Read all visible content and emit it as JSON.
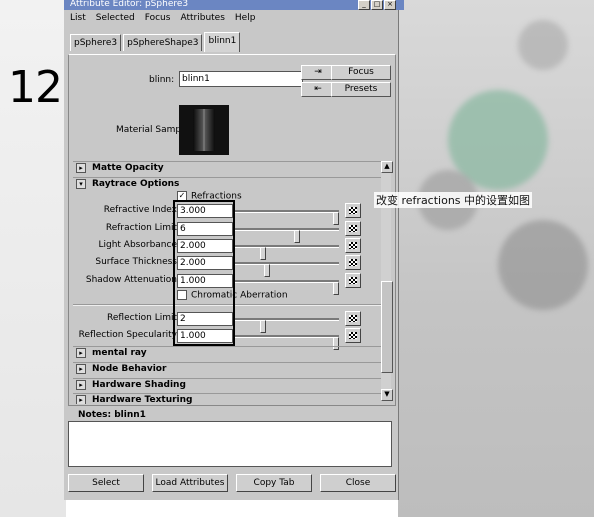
{
  "step_number": "12",
  "annotation": "改变 refractions 中的设置如图",
  "window": {
    "title": "Attribute Editor: pSphere3",
    "menu": [
      "List",
      "Selected",
      "Focus",
      "Attributes",
      "Help"
    ],
    "tabs": [
      "pSphere3",
      "pSphereShape3",
      "blinn1"
    ],
    "active_tab": 2
  },
  "node": {
    "label": "blinn:",
    "value": "blinn1",
    "focus_label": "Focus",
    "presets_label": "Presets",
    "material_sample_label": "Material Sample"
  },
  "sections": {
    "matte_opacity": "Matte Opacity",
    "raytrace_options": "Raytrace Options",
    "mental_ray": "mental ray",
    "node_behavior": "Node Behavior",
    "hardware_shading": "Hardware Shading",
    "hardware_texturing": "Hardware Texturing"
  },
  "raytrace": {
    "refractions_label": "Refractions",
    "refractions_checked": true,
    "chromatic_label": "Chromatic Aberration",
    "chromatic_checked": false,
    "attrs": [
      {
        "label": "Refractive Index",
        "value": "3.000",
        "slider": 1.0
      },
      {
        "label": "Refraction Limit",
        "value": "6",
        "slider": 0.6
      },
      {
        "label": "Light Absorbance",
        "value": "2.000",
        "slider": 0.25
      },
      {
        "label": "Surface Thickness",
        "value": "2.000",
        "slider": 0.3
      },
      {
        "label": "Shadow Attenuation",
        "value": "1.000",
        "slider": 1.0
      }
    ],
    "reflection_attrs": [
      {
        "label": "Reflection Limit",
        "value": "2",
        "slider": 0.25
      },
      {
        "label": "Reflection Specularity",
        "value": "1.000",
        "slider": 1.0
      }
    ]
  },
  "notes": {
    "label": "Notes: blinn1",
    "value": ""
  },
  "buttons": [
    "Select",
    "Load Attributes",
    "Copy Tab",
    "Close"
  ]
}
